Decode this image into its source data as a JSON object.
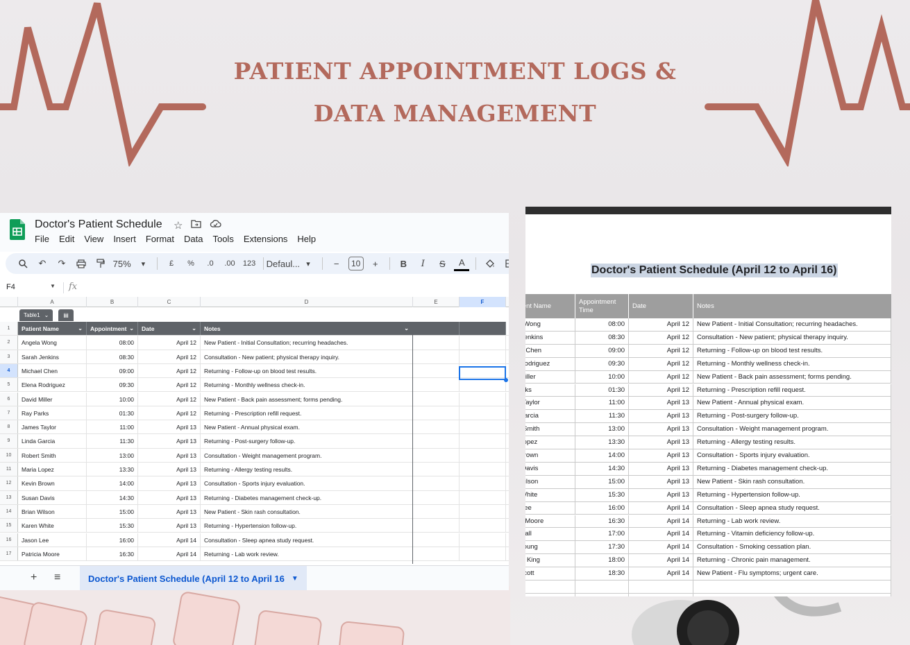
{
  "hero": {
    "line1": "PATIENT APPOINTMENT LOGS &",
    "line2": "DATA MANAGEMENT"
  },
  "colors": {
    "accent": "#b3695c",
    "sheets_green": "#0f9d58",
    "selection_blue": "#1a73e8"
  },
  "sheets": {
    "doc_title": "Doctor's Patient Schedule",
    "menus": [
      "File",
      "Edit",
      "View",
      "Insert",
      "Format",
      "Data",
      "Tools",
      "Extensions",
      "Help"
    ],
    "toolbar": {
      "zoom": "75%",
      "currency": "£",
      "percent": "%",
      "dec_decrease": ".0",
      "dec_increase": ".00",
      "number_format": "123",
      "font": "Defaul...",
      "font_size": "10",
      "bold": "B",
      "italic": "I",
      "strike": "S",
      "text_color": "A"
    },
    "name_box": "F4",
    "fx": "fx",
    "columns": [
      "A",
      "B",
      "C",
      "D",
      "E",
      "F"
    ],
    "table_name": "Table1",
    "headers": [
      "Patient Name",
      "Appointment",
      "Date",
      "Notes"
    ],
    "rows": [
      [
        "Angela Wong",
        "08:00",
        "April 12",
        "New Patient - Initial Consultation; recurring headaches."
      ],
      [
        "Sarah Jenkins",
        "08:30",
        "April 12",
        "Consultation - New patient; physical therapy inquiry."
      ],
      [
        "Michael Chen",
        "09:00",
        "April 12",
        "Returning - Follow-up on blood test results."
      ],
      [
        "Elena Rodriguez",
        "09:30",
        "April 12",
        "Returning - Monthly wellness check-in."
      ],
      [
        "David Miller",
        "10:00",
        "April 12",
        "New Patient - Back pain assessment; forms pending."
      ],
      [
        "Ray Parks",
        "01:30",
        "April 12",
        "Returning - Prescription refill request."
      ],
      [
        "James Taylor",
        "11:00",
        "April 13",
        "New Patient - Annual physical exam."
      ],
      [
        "Linda Garcia",
        "11:30",
        "April 13",
        "Returning - Post-surgery follow-up."
      ],
      [
        "Robert Smith",
        "13:00",
        "April 13",
        "Consultation - Weight management program."
      ],
      [
        "Maria Lopez",
        "13:30",
        "April 13",
        "Returning - Allergy testing results."
      ],
      [
        "Kevin Brown",
        "14:00",
        "April 13",
        "Consultation - Sports injury evaluation."
      ],
      [
        "Susan Davis",
        "14:30",
        "April 13",
        "Returning - Diabetes management check-up."
      ],
      [
        "Brian Wilson",
        "15:00",
        "April 13",
        "New Patient - Skin rash consultation."
      ],
      [
        "Karen White",
        "15:30",
        "April 13",
        "Returning - Hypertension follow-up."
      ],
      [
        "Jason Lee",
        "16:00",
        "April 14",
        "Consultation - Sleep apnea study request."
      ],
      [
        "Patricia Moore",
        "16:30",
        "April 14",
        "Returning - Lab work review."
      ]
    ],
    "row_numbers": [
      "1",
      "2",
      "3",
      "4",
      "5",
      "6",
      "7",
      "8",
      "9",
      "10",
      "11",
      "12",
      "13",
      "14",
      "15",
      "16",
      "17"
    ],
    "active_tab": "Doctor's Patient Schedule (April 12 to April 16"
  },
  "preview": {
    "title": "Doctor's Patient Schedule (April 12 to April 16)",
    "headers": [
      "Patient Name",
      "Appointment Time",
      "Date",
      "Notes"
    ],
    "rows": [
      [
        "Angela Wong",
        "08:00",
        "April 12",
        "New Patient - Initial Consultation; recurring headaches."
      ],
      [
        "Sarah Jenkins",
        "08:30",
        "April 12",
        "Consultation - New patient; physical therapy inquiry."
      ],
      [
        "Michael Chen",
        "09:00",
        "April 12",
        "Returning - Follow-up on blood test results."
      ],
      [
        "Elena Rodriguez",
        "09:30",
        "April 12",
        "Returning - Monthly wellness check-in."
      ],
      [
        "David Miller",
        "10:00",
        "April 12",
        "New Patient - Back pain assessment; forms pending."
      ],
      [
        "Ray Parks",
        "01:30",
        "April 12",
        "Returning - Prescription refill request."
      ],
      [
        "James Taylor",
        "11:00",
        "April 13",
        "New Patient - Annual physical exam."
      ],
      [
        "Linda Garcia",
        "11:30",
        "April 13",
        "Returning - Post-surgery follow-up."
      ],
      [
        "Robert Smith",
        "13:00",
        "April 13",
        "Consultation - Weight management program."
      ],
      [
        "Maria Lopez",
        "13:30",
        "April 13",
        "Returning - Allergy testing results."
      ],
      [
        "Kevin Brown",
        "14:00",
        "April 13",
        "Consultation - Sports injury evaluation."
      ],
      [
        "Susan Davis",
        "14:30",
        "April 13",
        "Returning - Diabetes management check-up."
      ],
      [
        "Brian Wilson",
        "15:00",
        "April 13",
        "New Patient - Skin rash consultation."
      ],
      [
        "Karen White",
        "15:30",
        "April 13",
        "Returning - Hypertension follow-up."
      ],
      [
        "Jason Lee",
        "16:00",
        "April 14",
        "Consultation - Sleep apnea study request."
      ],
      [
        "Patricia Moore",
        "16:30",
        "April 14",
        "Returning - Lab work review."
      ],
      [
        "Ethan Hall",
        "17:00",
        "April 14",
        "Returning - Vitamin deficiency follow-up."
      ],
      [
        "Olivia Young",
        "17:30",
        "April 14",
        "Consultation - Smoking cessation plan."
      ],
      [
        "Thomas King",
        "18:00",
        "April 14",
        "Returning - Chronic pain management."
      ],
      [
        "Emily Scott",
        "18:30",
        "April 14",
        "New Patient - Flu symptoms; urgent care."
      ]
    ]
  }
}
